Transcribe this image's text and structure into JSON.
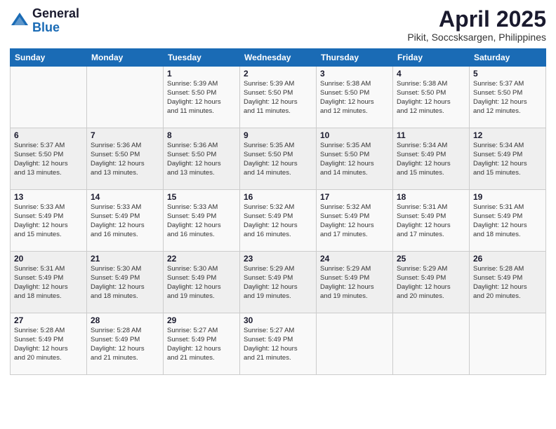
{
  "logo": {
    "general": "General",
    "blue": "Blue"
  },
  "title": "April 2025",
  "location": "Pikit, Soccsksargen, Philippines",
  "weekdays": [
    "Sunday",
    "Monday",
    "Tuesday",
    "Wednesday",
    "Thursday",
    "Friday",
    "Saturday"
  ],
  "weeks": [
    [
      {
        "day": "",
        "info": ""
      },
      {
        "day": "",
        "info": ""
      },
      {
        "day": "1",
        "info": "Sunrise: 5:39 AM\nSunset: 5:50 PM\nDaylight: 12 hours\nand 11 minutes."
      },
      {
        "day": "2",
        "info": "Sunrise: 5:39 AM\nSunset: 5:50 PM\nDaylight: 12 hours\nand 11 minutes."
      },
      {
        "day": "3",
        "info": "Sunrise: 5:38 AM\nSunset: 5:50 PM\nDaylight: 12 hours\nand 12 minutes."
      },
      {
        "day": "4",
        "info": "Sunrise: 5:38 AM\nSunset: 5:50 PM\nDaylight: 12 hours\nand 12 minutes."
      },
      {
        "day": "5",
        "info": "Sunrise: 5:37 AM\nSunset: 5:50 PM\nDaylight: 12 hours\nand 12 minutes."
      }
    ],
    [
      {
        "day": "6",
        "info": "Sunrise: 5:37 AM\nSunset: 5:50 PM\nDaylight: 12 hours\nand 13 minutes."
      },
      {
        "day": "7",
        "info": "Sunrise: 5:36 AM\nSunset: 5:50 PM\nDaylight: 12 hours\nand 13 minutes."
      },
      {
        "day": "8",
        "info": "Sunrise: 5:36 AM\nSunset: 5:50 PM\nDaylight: 12 hours\nand 13 minutes."
      },
      {
        "day": "9",
        "info": "Sunrise: 5:35 AM\nSunset: 5:50 PM\nDaylight: 12 hours\nand 14 minutes."
      },
      {
        "day": "10",
        "info": "Sunrise: 5:35 AM\nSunset: 5:50 PM\nDaylight: 12 hours\nand 14 minutes."
      },
      {
        "day": "11",
        "info": "Sunrise: 5:34 AM\nSunset: 5:49 PM\nDaylight: 12 hours\nand 15 minutes."
      },
      {
        "day": "12",
        "info": "Sunrise: 5:34 AM\nSunset: 5:49 PM\nDaylight: 12 hours\nand 15 minutes."
      }
    ],
    [
      {
        "day": "13",
        "info": "Sunrise: 5:33 AM\nSunset: 5:49 PM\nDaylight: 12 hours\nand 15 minutes."
      },
      {
        "day": "14",
        "info": "Sunrise: 5:33 AM\nSunset: 5:49 PM\nDaylight: 12 hours\nand 16 minutes."
      },
      {
        "day": "15",
        "info": "Sunrise: 5:33 AM\nSunset: 5:49 PM\nDaylight: 12 hours\nand 16 minutes."
      },
      {
        "day": "16",
        "info": "Sunrise: 5:32 AM\nSunset: 5:49 PM\nDaylight: 12 hours\nand 16 minutes."
      },
      {
        "day": "17",
        "info": "Sunrise: 5:32 AM\nSunset: 5:49 PM\nDaylight: 12 hours\nand 17 minutes."
      },
      {
        "day": "18",
        "info": "Sunrise: 5:31 AM\nSunset: 5:49 PM\nDaylight: 12 hours\nand 17 minutes."
      },
      {
        "day": "19",
        "info": "Sunrise: 5:31 AM\nSunset: 5:49 PM\nDaylight: 12 hours\nand 18 minutes."
      }
    ],
    [
      {
        "day": "20",
        "info": "Sunrise: 5:31 AM\nSunset: 5:49 PM\nDaylight: 12 hours\nand 18 minutes."
      },
      {
        "day": "21",
        "info": "Sunrise: 5:30 AM\nSunset: 5:49 PM\nDaylight: 12 hours\nand 18 minutes."
      },
      {
        "day": "22",
        "info": "Sunrise: 5:30 AM\nSunset: 5:49 PM\nDaylight: 12 hours\nand 19 minutes."
      },
      {
        "day": "23",
        "info": "Sunrise: 5:29 AM\nSunset: 5:49 PM\nDaylight: 12 hours\nand 19 minutes."
      },
      {
        "day": "24",
        "info": "Sunrise: 5:29 AM\nSunset: 5:49 PM\nDaylight: 12 hours\nand 19 minutes."
      },
      {
        "day": "25",
        "info": "Sunrise: 5:29 AM\nSunset: 5:49 PM\nDaylight: 12 hours\nand 20 minutes."
      },
      {
        "day": "26",
        "info": "Sunrise: 5:28 AM\nSunset: 5:49 PM\nDaylight: 12 hours\nand 20 minutes."
      }
    ],
    [
      {
        "day": "27",
        "info": "Sunrise: 5:28 AM\nSunset: 5:49 PM\nDaylight: 12 hours\nand 20 minutes."
      },
      {
        "day": "28",
        "info": "Sunrise: 5:28 AM\nSunset: 5:49 PM\nDaylight: 12 hours\nand 21 minutes."
      },
      {
        "day": "29",
        "info": "Sunrise: 5:27 AM\nSunset: 5:49 PM\nDaylight: 12 hours\nand 21 minutes."
      },
      {
        "day": "30",
        "info": "Sunrise: 5:27 AM\nSunset: 5:49 PM\nDaylight: 12 hours\nand 21 minutes."
      },
      {
        "day": "",
        "info": ""
      },
      {
        "day": "",
        "info": ""
      },
      {
        "day": "",
        "info": ""
      }
    ]
  ]
}
